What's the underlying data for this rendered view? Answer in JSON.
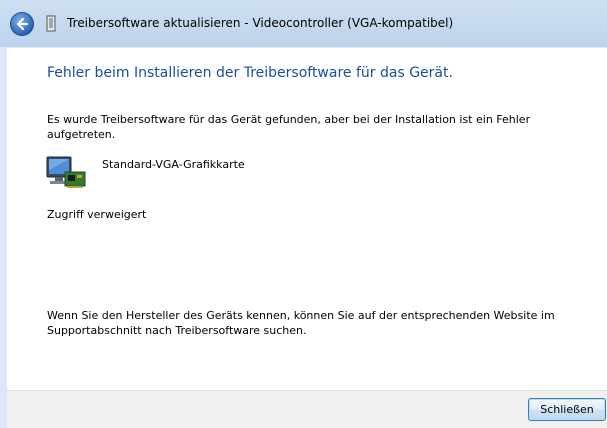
{
  "window": {
    "title": "Treibersoftware aktualisieren - Videocontroller (VGA-kompatibel)"
  },
  "icons": {
    "back": "back-arrow-icon",
    "wizard": "hardware-wizard-icon",
    "device": "monitor-graphics-card-icon"
  },
  "content": {
    "heading": "Fehler beim Installieren der Treibersoftware für das Gerät.",
    "description": "Es wurde Treibersoftware für das Gerät gefunden, aber bei der Installation ist ein Fehler aufgetreten.",
    "device_name": "Standard-VGA-Grafikkarte",
    "error_message": "Zugriff verweigert",
    "hint": "Wenn Sie den Hersteller des Geräts kennen, können Sie auf der entsprechenden Website im Supportabschnitt nach Treibersoftware suchen."
  },
  "footer": {
    "close_label": "Schließen"
  },
  "colors": {
    "heading": "#1b4fa0",
    "chrome": "#dbe8f5",
    "footer": "#f0f0f0"
  }
}
